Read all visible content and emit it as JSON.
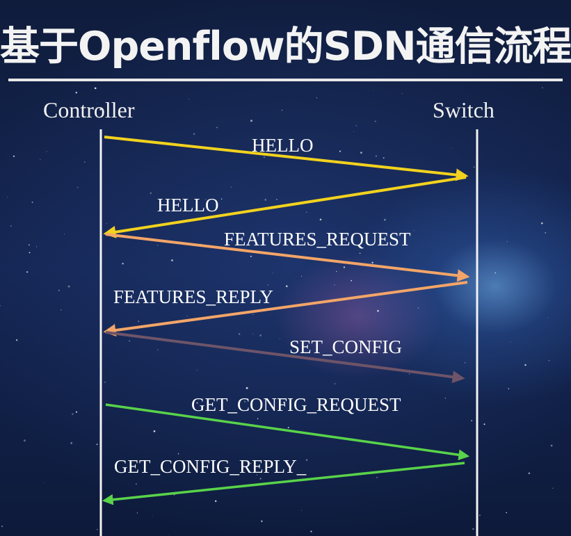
{
  "title": "基于Openflow的SDN通信流程",
  "parties": {
    "controller": "Controller",
    "switch": "Switch"
  },
  "colors": {
    "hello": "#f2d21e",
    "features": "#f3a568",
    "set_config": "#6e5468",
    "get_config": "#59d34a"
  },
  "messages": [
    {
      "label": "HELLO",
      "direction": "controller-to-switch",
      "color": "#f2d21e"
    },
    {
      "label": "HELLO",
      "direction": "switch-to-controller",
      "color": "#f2d21e"
    },
    {
      "label": "FEATURES_REQUEST",
      "direction": "controller-to-switch",
      "color": "#f3a568"
    },
    {
      "label": "FEATURES_REPLY",
      "direction": "switch-to-controller",
      "color": "#f3a568"
    },
    {
      "label": "SET_CONFIG",
      "direction": "controller-to-switch",
      "color": "#6e5468"
    },
    {
      "label": "GET_CONFIG_REQUEST",
      "direction": "controller-to-switch",
      "color": "#59d34a"
    },
    {
      "label": "GET_CONFIG_REPLY_",
      "direction": "switch-to-controller",
      "color": "#59d34a"
    }
  ]
}
